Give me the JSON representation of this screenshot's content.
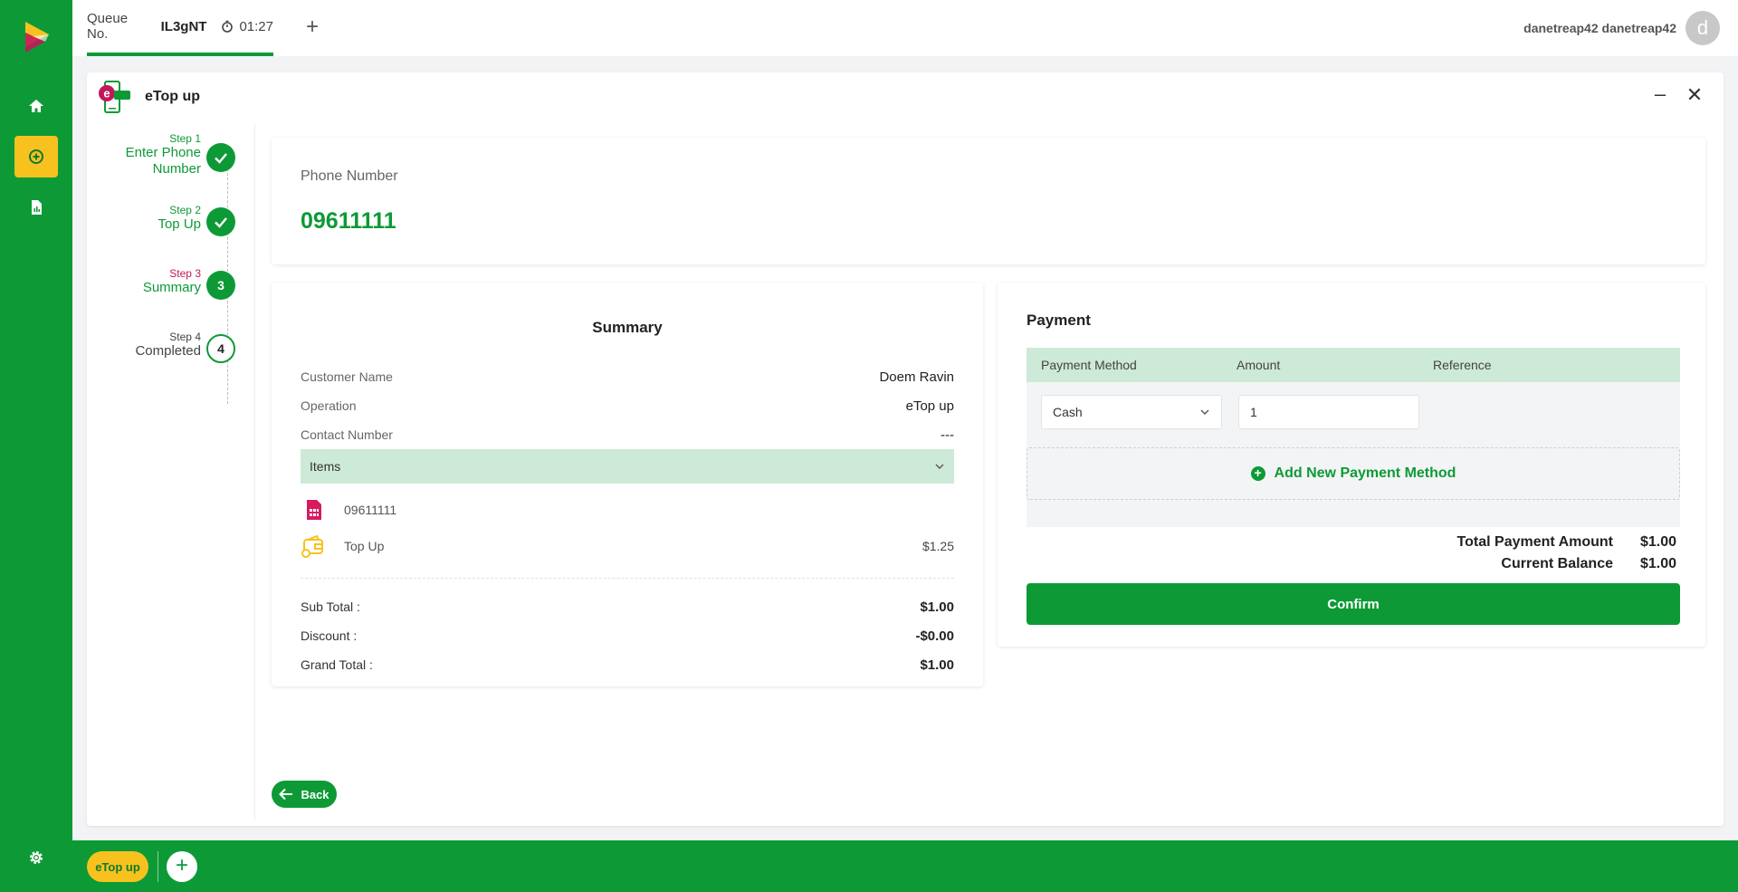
{
  "topbar": {
    "queue_label": "Queue No.",
    "queue_number": "IL3gNT",
    "timer": "01:27",
    "add_tab": "+",
    "username": "danetreap42 danetreap42",
    "avatar_letter": "d"
  },
  "rail": {
    "items": [
      "home-icon",
      "add-circle-icon",
      "report-icon"
    ],
    "settings": "gear-icon"
  },
  "panel": {
    "title": "eTop up",
    "minimize": "–",
    "close": "✕"
  },
  "steps": [
    {
      "small": "Step 1",
      "label_line1": "Enter Phone",
      "label_line2": "Number",
      "status": "done"
    },
    {
      "small": "Step 2",
      "label_line1": "Top Up",
      "label_line2": "",
      "status": "done"
    },
    {
      "small": "Step 3",
      "label_line1": "Summary",
      "label_line2": "",
      "status": "active",
      "number": "3"
    },
    {
      "small": "Step 4",
      "label_line1": "Completed",
      "label_line2": "",
      "status": "pending",
      "number": "4"
    }
  ],
  "phone": {
    "label": "Phone Number",
    "value": "09611111"
  },
  "summary": {
    "title": "Summary",
    "rows": [
      {
        "key": "Customer Name",
        "value": "Doem Ravin"
      },
      {
        "key": "Operation",
        "value": "eTop up"
      },
      {
        "key": "Contact Number",
        "value": "---"
      }
    ],
    "items_label": "Items",
    "items": [
      {
        "name": "09611111",
        "price": "",
        "icon": "sim-card-icon"
      },
      {
        "name": "Top Up",
        "price": "$1.25",
        "icon": "wallet-icon"
      }
    ],
    "totals": [
      {
        "key": "Sub Total :",
        "value": "$1.00"
      },
      {
        "key": "Discount :",
        "value": "-$0.00"
      },
      {
        "key": "Grand Total :",
        "value": "$1.00"
      }
    ]
  },
  "payment": {
    "title": "Payment",
    "headers": [
      "Payment Method",
      "Amount",
      "Reference"
    ],
    "method": "Cash",
    "amount": "1",
    "add_method": "Add New Payment Method",
    "total_label": "Total Payment Amount",
    "total_value": "$1.00",
    "balance_label": "Current Balance",
    "balance_value": "$1.00",
    "confirm": "Confirm"
  },
  "back": "Back",
  "bottombar": {
    "chip": "eTop up",
    "add": "+"
  },
  "colors": {
    "brand_green": "#0d9a36",
    "accent_yellow": "#f7c21e",
    "light_green": "#cde9d7",
    "step_pink": "#c2185b"
  }
}
